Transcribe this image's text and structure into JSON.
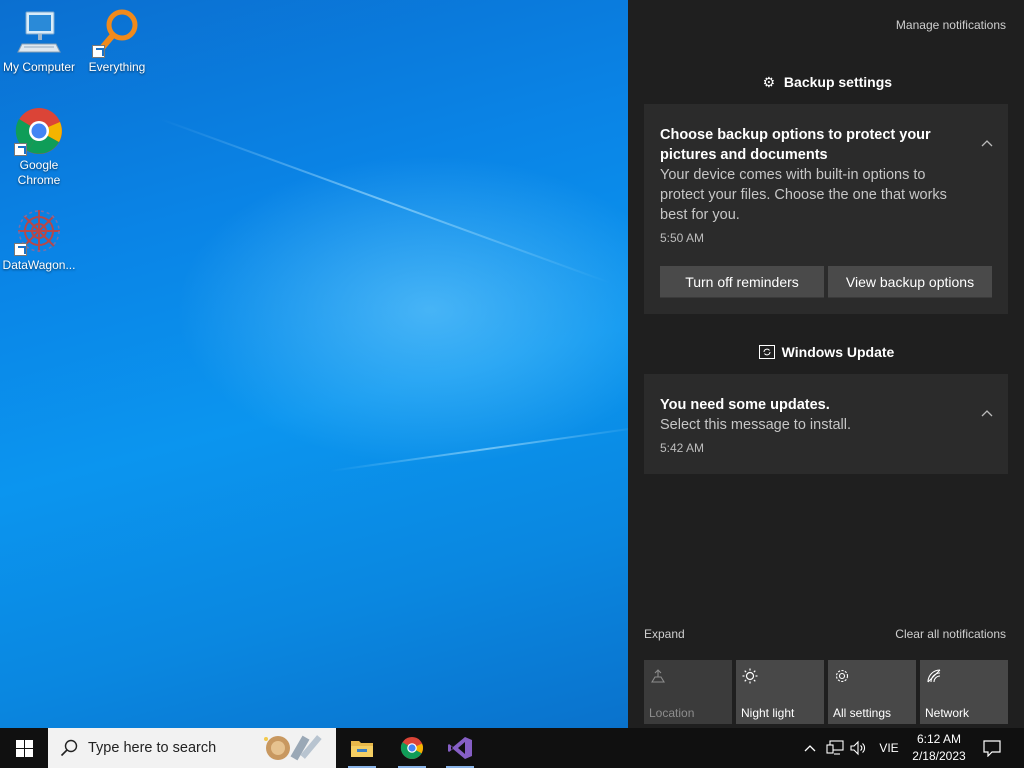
{
  "desktop": {
    "icons": [
      {
        "label": "My Computer",
        "icon": "computer-icon"
      },
      {
        "label": "Everything",
        "icon": "magnifier-icon"
      },
      {
        "label": "Google Chrome",
        "icon": "chrome-icon"
      },
      {
        "label": "DataWagon...",
        "icon": "datawagon-icon"
      }
    ]
  },
  "action_center": {
    "manage_notifications": "Manage notifications",
    "groups": [
      {
        "header": "Backup settings",
        "icon": "gear-icon",
        "notification": {
          "title": "Choose backup options to protect your pictures and documents",
          "body": "Your device comes with built-in options to protect your files. Choose the one that works best for you.",
          "time": "5:50 AM",
          "buttons": [
            "Turn off reminders",
            "View backup options"
          ]
        }
      },
      {
        "header": "Windows Update",
        "icon": "windows-update-icon",
        "notification": {
          "title": "You need some updates.",
          "body": "Select this message to install.",
          "time": "5:42 AM"
        }
      }
    ],
    "expand": "Expand",
    "clear_all": "Clear all notifications",
    "quick_actions": [
      {
        "label": "Location",
        "icon": "location-icon",
        "enabled": false
      },
      {
        "label": "Night light",
        "icon": "night-light-icon",
        "enabled": true
      },
      {
        "label": "All settings",
        "icon": "gear-icon",
        "enabled": true
      },
      {
        "label": "Network",
        "icon": "network-icon",
        "enabled": true
      }
    ]
  },
  "taskbar": {
    "search_placeholder": "Type here to search",
    "pinned_apps": [
      "file-explorer-icon",
      "chrome-icon",
      "visual-studio-icon"
    ],
    "tray": {
      "language": "VIE",
      "time": "6:12 AM",
      "date": "2/18/2023"
    }
  },
  "colors": {
    "desktop_blue": "#0a84e6",
    "action_center_bg": "#1f1f1f",
    "card_bg": "#2b2b2b",
    "button_bg": "#4a4a4a",
    "taskbar_bg": "#101010"
  }
}
